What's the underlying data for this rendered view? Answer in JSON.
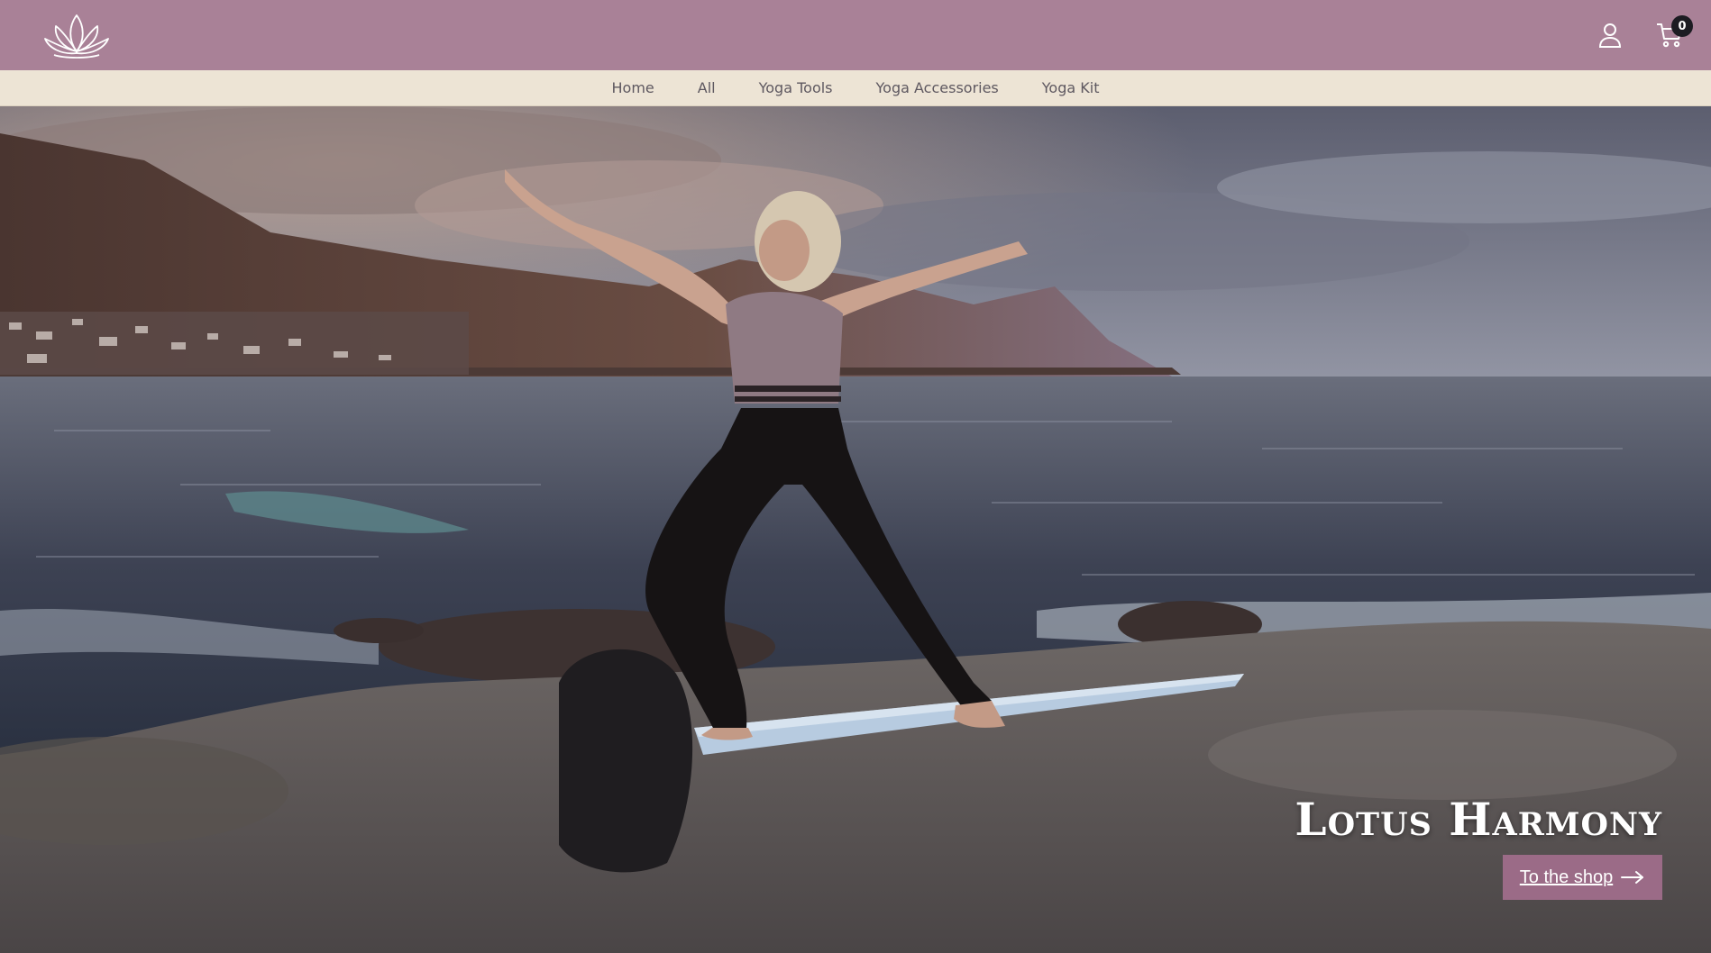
{
  "header": {
    "logo_icon": "lotus-logo-icon",
    "account_icon": "user-icon",
    "cart_icon": "shopping-cart-icon",
    "cart_count": "0",
    "background_color": "#a98197"
  },
  "nav": {
    "items": [
      {
        "label": "Home"
      },
      {
        "label": "All"
      },
      {
        "label": "Yoga Tools"
      },
      {
        "label": "Yoga Accessories"
      },
      {
        "label": "Yoga Kit"
      }
    ],
    "background_color": "#ede4d5"
  },
  "hero": {
    "title": "Lotus Harmony",
    "button_label": "To the shop",
    "button_icon": "arrow-right-icon",
    "button_color": "#9b6b87"
  }
}
